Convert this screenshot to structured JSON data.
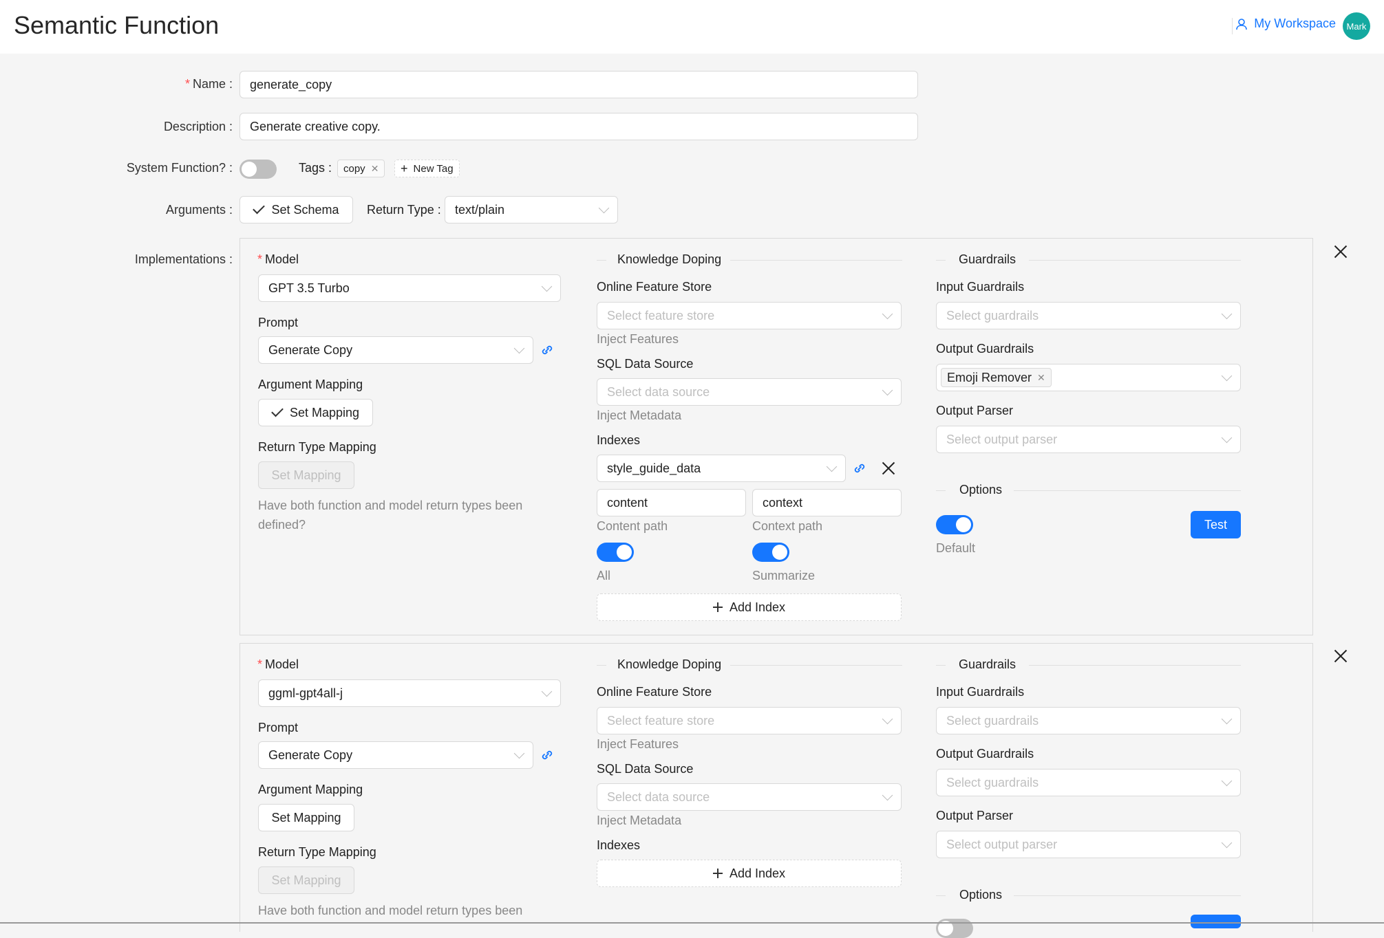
{
  "header": {
    "title": "Semantic Function",
    "workspace_label": "My Workspace",
    "avatar_label": "Mark"
  },
  "form": {
    "name_label": "Name",
    "name_value": "generate_copy",
    "description_label": "Description",
    "description_value": "Generate creative copy.",
    "system_function_label": "System Function?",
    "tags_label": "Tags",
    "tags": [
      "copy"
    ],
    "new_tag_label": "New Tag",
    "arguments_label": "Arguments",
    "set_schema_label": "Set Schema",
    "return_type_label": "Return Type",
    "return_type_value": "text/plain",
    "implementations_label": "Implementations"
  },
  "implementations": [
    {
      "model_label": "Model",
      "model_value": "GPT 3.5 Turbo",
      "prompt_label": "Prompt",
      "prompt_value": "Generate Copy",
      "arg_mapping_label": "Argument Mapping",
      "arg_mapping_button": "Set Mapping",
      "return_mapping_label": "Return Type Mapping",
      "return_mapping_button": "Set Mapping",
      "help_text": "Have both function and model return types been defined?",
      "knowledge_title": "Knowledge Doping",
      "feature_store_label": "Online Feature Store",
      "feature_store_placeholder": "Select feature store",
      "inject_features": "Inject Features",
      "sql_label": "SQL Data Source",
      "sql_placeholder": "Select data source",
      "inject_metadata": "Inject Metadata",
      "indexes_label": "Indexes",
      "index_value": "style_guide_data",
      "content_value": "content",
      "content_path_label": "Content path",
      "context_value": "context",
      "context_path_label": "Context path",
      "all_label": "All",
      "summarize_label": "Summarize",
      "add_index_label": "Add Index",
      "guardrails_title": "Guardrails",
      "input_guardrails_label": "Input Guardrails",
      "input_guardrails_placeholder": "Select guardrails",
      "output_guardrails_label": "Output Guardrails",
      "output_guardrail_tag": "Emoji Remover",
      "output_parser_label": "Output Parser",
      "output_parser_placeholder": "Select output parser",
      "options_title": "Options",
      "default_label": "Default",
      "test_label": "Test"
    },
    {
      "model_label": "Model",
      "model_value": "ggml-gpt4all-j",
      "prompt_label": "Prompt",
      "prompt_value": "Generate Copy",
      "arg_mapping_label": "Argument Mapping",
      "arg_mapping_button": "Set Mapping",
      "return_mapping_label": "Return Type Mapping",
      "return_mapping_button": "Set Mapping",
      "help_text": "Have both function and model return types been",
      "knowledge_title": "Knowledge Doping",
      "feature_store_label": "Online Feature Store",
      "feature_store_placeholder": "Select feature store",
      "inject_features": "Inject Features",
      "sql_label": "SQL Data Source",
      "sql_placeholder": "Select data source",
      "inject_metadata": "Inject Metadata",
      "indexes_label": "Indexes",
      "add_index_label": "Add Index",
      "guardrails_title": "Guardrails",
      "input_guardrails_label": "Input Guardrails",
      "input_guardrails_placeholder": "Select guardrails",
      "output_guardrails_label": "Output Guardrails",
      "output_guardrails_placeholder": "Select guardrails",
      "output_parser_label": "Output Parser",
      "output_parser_placeholder": "Select output parser",
      "options_title": "Options"
    }
  ],
  "colors": {
    "primary": "#1677ff",
    "required": "#ff4d4f",
    "avatar": "#14a9a0"
  }
}
